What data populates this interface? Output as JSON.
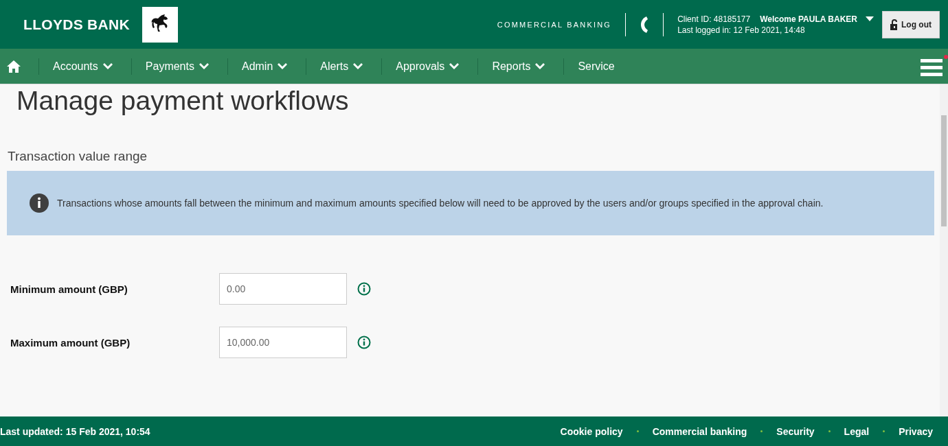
{
  "header": {
    "brand": "LLOYDS BANK",
    "division": "COMMERCIAL BANKING",
    "client_id": "Client ID: 48185177",
    "welcome": "Welcome PAULA BAKER",
    "last_logged_in": "Last logged in: 12 Feb 2021, 14:48",
    "logout": "Log out"
  },
  "nav": [
    {
      "label": "Accounts",
      "dropdown": true
    },
    {
      "label": "Payments",
      "dropdown": true
    },
    {
      "label": "Admin",
      "dropdown": true
    },
    {
      "label": "Alerts",
      "dropdown": true
    },
    {
      "label": "Approvals",
      "dropdown": true
    },
    {
      "label": "Reports",
      "dropdown": true
    },
    {
      "label": "Service",
      "dropdown": false
    }
  ],
  "page": {
    "title": "Manage payment workflows",
    "section": "Transaction value range",
    "info": "Transactions whose amounts fall between the minimum and maximum amounts specified below will need to be approved by the users and/or groups specified in the approval chain.",
    "fields": [
      {
        "label": "Minimum amount (GBP)",
        "value": "0.00"
      },
      {
        "label": "Maximum amount (GBP)",
        "value": "10,000.00"
      }
    ]
  },
  "footer": {
    "updated": "Last updated: 15 Feb 2021, 10:54",
    "links": [
      "Cookie policy",
      "Commercial banking",
      "Security",
      "Legal",
      "Privacy"
    ]
  }
}
